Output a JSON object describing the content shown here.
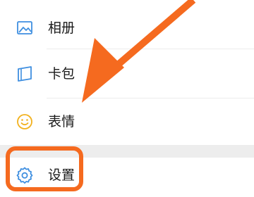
{
  "menu": {
    "items": [
      {
        "label": "相册",
        "icon": "photo-album-icon"
      },
      {
        "label": "卡包",
        "icon": "card-wallet-icon"
      },
      {
        "label": "表情",
        "icon": "smiley-icon"
      },
      {
        "label": "设置",
        "icon": "gear-icon"
      }
    ]
  },
  "annotation": {
    "highlight_target": "设置",
    "arrow_direction": "down-left",
    "color": "#f56a1f"
  },
  "colors": {
    "icon_blue": "#3f8fe0",
    "icon_yellow": "#f2b11d",
    "text": "#1a1a1a",
    "divider": "#ececec",
    "section_gap": "#ededed"
  }
}
